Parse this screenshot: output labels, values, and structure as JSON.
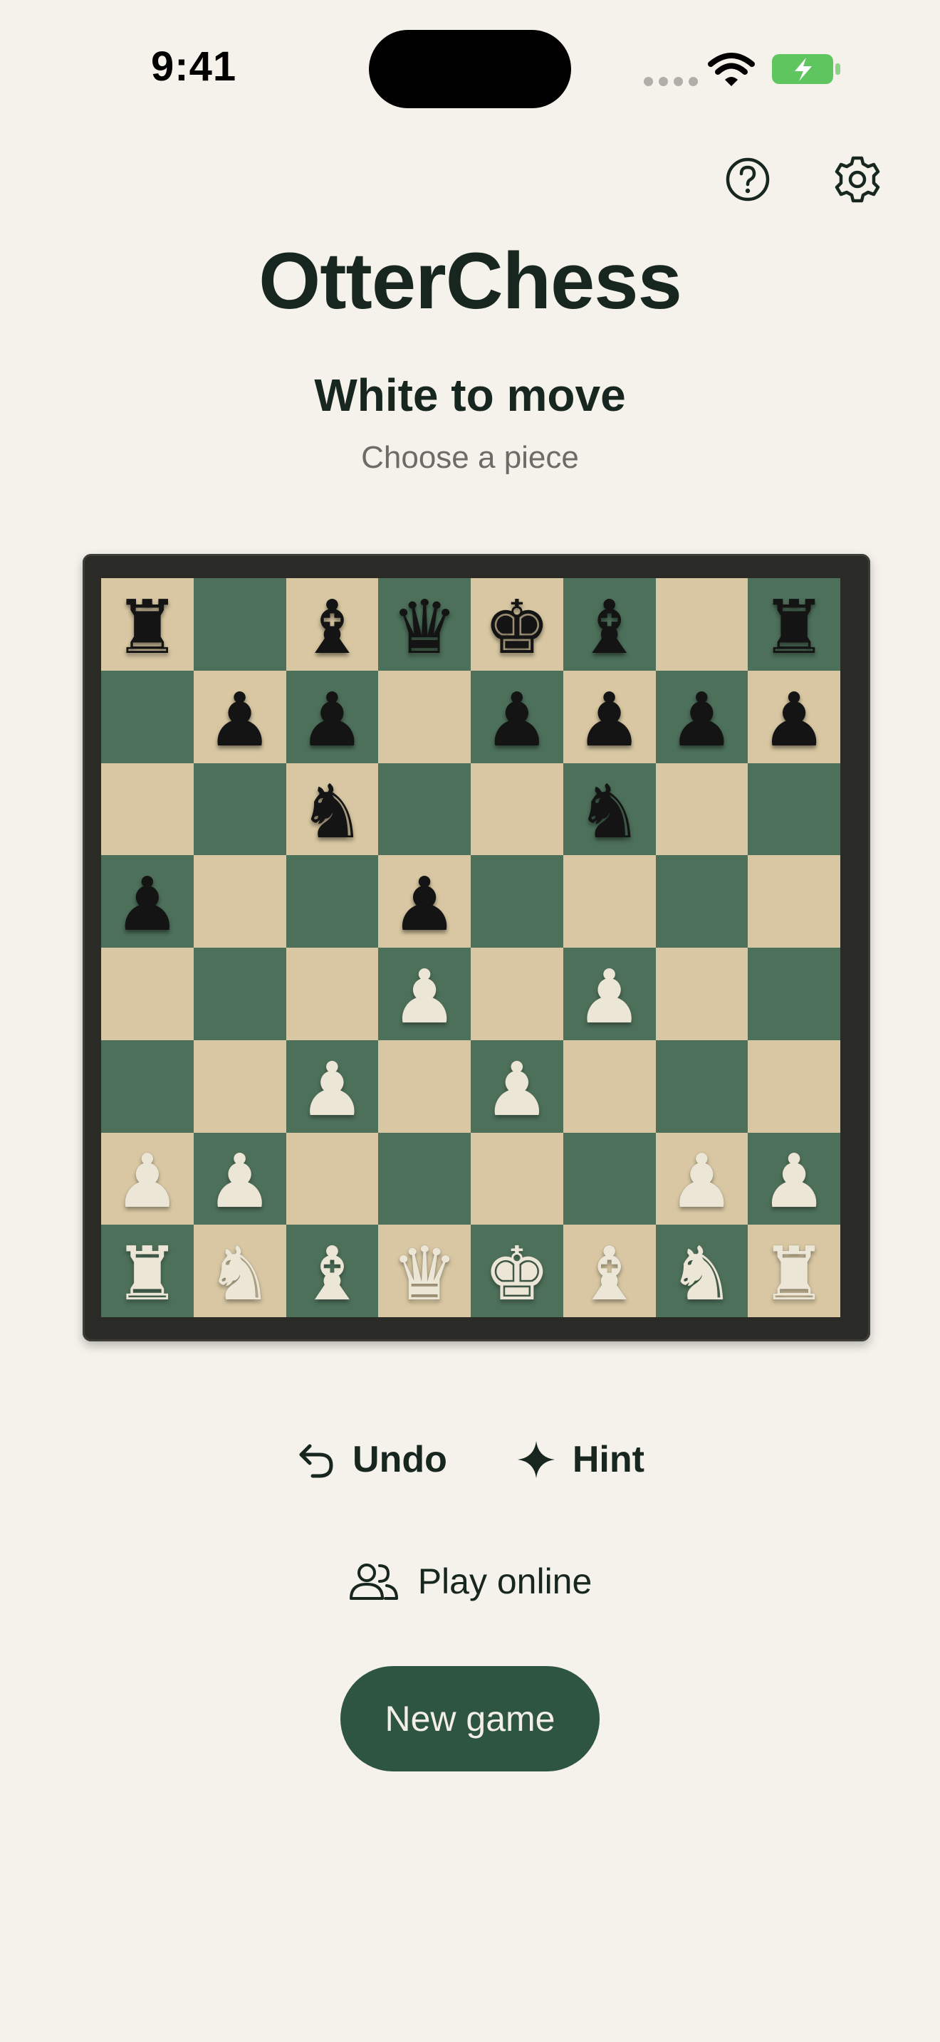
{
  "status_bar": {
    "time": "9:41",
    "battery_color": "#5fc65f"
  },
  "app": {
    "title": "OtterChess"
  },
  "game": {
    "turn_label": "White to move",
    "turn_hint": "Choose a piece"
  },
  "board": {
    "light_color": "#d8c7a2",
    "dark_color": "#4d705a",
    "rows": [
      [
        "br",
        "",
        "bb",
        "bq",
        "bk",
        "bb",
        "",
        "br"
      ],
      [
        "",
        "bp",
        "bp",
        "",
        "bp",
        "bp",
        "bp",
        "bp"
      ],
      [
        "",
        "",
        "bn",
        "",
        "",
        "bn",
        "",
        ""
      ],
      [
        "bp",
        "",
        "",
        "bp",
        "",
        "",
        "",
        ""
      ],
      [
        "",
        "",
        "",
        "wp",
        "",
        "wp",
        "",
        ""
      ],
      [
        "",
        "",
        "wp",
        "",
        "wp",
        "",
        "",
        ""
      ],
      [
        "wp",
        "wp",
        "",
        "",
        "",
        "",
        "wp",
        "wp"
      ],
      [
        "wr",
        "wn",
        "wb",
        "wq",
        "wk",
        "wb",
        "wn",
        "wr"
      ]
    ]
  },
  "controls": {
    "undo_label": "Undo",
    "hint_label": "Hint",
    "online_label": "Play online"
  },
  "new_game": {
    "label": "New game",
    "color": "#2e5541"
  },
  "icons": [
    "help-icon",
    "gear-icon",
    "undo-icon",
    "sparkle-icon",
    "users-icon"
  ]
}
